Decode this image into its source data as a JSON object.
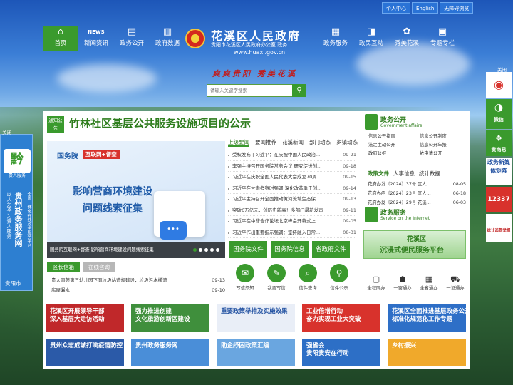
{
  "topbar": [
    "个人中心",
    "English",
    "无障碍浏览"
  ],
  "nav": {
    "items": [
      {
        "label": "首页",
        "icon": "⌂",
        "active": true
      },
      {
        "label": "新闻资讯",
        "icon": "NEWS"
      },
      {
        "label": "政务公开",
        "icon": "▤"
      },
      {
        "label": "政府数据",
        "icon": "▥"
      },
      {
        "label": "政务服务",
        "icon": "▦"
      },
      {
        "label": "政民互动",
        "icon": "◨"
      },
      {
        "label": "秀美花溪",
        "icon": "✿"
      },
      {
        "label": "专题专栏",
        "icon": "▣"
      }
    ]
  },
  "logo": {
    "title": "花溪区人民政府",
    "subtitle": "贵阳市花溪区人民政府办公室.政务",
    "url": "www.huaxi.gov.cn"
  },
  "slogan": "爽爽贵阳 秀美花溪",
  "search": {
    "placeholder": "请输入关键字搜索",
    "button_icon": "search-icon"
  },
  "headline": {
    "badge": "通知公告",
    "title": "竹林社区基层公共服务设施项目的公示"
  },
  "banner": {
    "org": "国务院",
    "tag": "互联网+督查",
    "line1": "影响营商环境建设",
    "line2": "问题线索征集",
    "caption": "国务院互联网+督查 影响营商环境建设问题线索征集",
    "dots": 5,
    "active_dot": 0
  },
  "news": {
    "tabs": [
      "上级要闻",
      "要闻推荐",
      "花溪新闻",
      "部门动态",
      "乡镇动态"
    ],
    "active_tab": 0,
    "items": [
      {
        "title": "受权发布丨习近平：在庆祝中国人民政治...",
        "date": "09-21"
      },
      {
        "title": "李强主持召开国务院常务会议 研究促进创...",
        "date": "09-18"
      },
      {
        "title": "习近平在庆祝全国人民代表大会成立70周...",
        "date": "09-15"
      },
      {
        "title": "习近平在甘肃考察时强调 深化改革勇于创...",
        "date": "09-14"
      },
      {
        "title": "习近平主持召开全面推动黄河流域生态保...",
        "date": "09-13"
      },
      {
        "title": "突破6万亿元，创历史新高！多部门最新发声",
        "date": "09-11"
      },
      {
        "title": "习近平在中非合作论坛北京峰会开幕式上...",
        "date": "09-05"
      },
      {
        "title": "习近平作出重要指示强调：坚持融入日常...",
        "date": "08-31"
      }
    ],
    "buttons": [
      "国务院文件",
      "国务院信息",
      "省政府文件"
    ]
  },
  "mailbox": {
    "tabs": [
      "区长信箱",
      "在线咨询"
    ],
    "items": [
      {
        "title": "贵大南苑第三幼儿园下面垃圾站违规建设，垃圾污水横流",
        "date": "09-13"
      },
      {
        "title": "房屋漏水",
        "date": "09-10"
      }
    ],
    "actions": [
      {
        "label": "写信须知",
        "icon": "✉"
      },
      {
        "label": "我要写信",
        "icon": "✎"
      },
      {
        "label": "信件查询",
        "icon": "⌕"
      },
      {
        "label": "信件公示",
        "icon": "⚲"
      }
    ]
  },
  "gov_open": {
    "title": "政务公开",
    "subtitle": "Government affairs",
    "links": [
      "信息公开指南",
      "信息公开制度",
      "法定主动公开",
      "信息公开年报",
      "政府公报",
      "依申请公开"
    ]
  },
  "files": {
    "tabs": [
      "政策文件",
      "人事信息",
      "统计数据"
    ],
    "items": [
      {
        "title": "花府办发〔2024〕37号 区人...",
        "date": "08-05"
      },
      {
        "title": "花府办函〔2024〕23号 区人...",
        "date": "06-18"
      },
      {
        "title": "花府办发〔2024〕29号 花溪...",
        "date": "06-03"
      }
    ]
  },
  "service": {
    "title": "政务服务",
    "subtitle": "Service on the Internet",
    "banner_a": "花溪区",
    "banner_b": "沉浸式便民服务平台",
    "links": [
      {
        "label": "全程网办",
        "icon": "▢"
      },
      {
        "label": "一窗通办",
        "icon": "☗"
      },
      {
        "label": "全省通办",
        "icon": "▦"
      },
      {
        "label": "一证通办",
        "icon": "⛟"
      }
    ]
  },
  "thumbs": [
    {
      "text": "花溪区开展领导干部\n深入基层大走访活动",
      "bg": "#c0282a"
    },
    {
      "text": "强力推进创建\n文化旅游创新区建设",
      "bg": "#3f8f3c"
    },
    {
      "text": "重要政策举措及实施效果",
      "bg": "#e9eef7",
      "color": "#1f4fa0"
    },
    {
      "text": "工业倍增行动\n奋力实现工业大突破",
      "bg": "#d8322c"
    },
    {
      "text": "花溪区全面推进基层政务公开\n标准化规范化工作专题",
      "bg": "#2e6fc7"
    },
    {
      "text": "贵州众志成城打响疫情防控",
      "bg": "#2b5aa8"
    },
    {
      "text": "贵州政务服务网",
      "bg": "#4a8ed8"
    },
    {
      "text": "助企纾困政策汇编",
      "bg": "#6aa6e0"
    },
    {
      "text": "强省会\n贵阳贵安在行动",
      "bg": "#2d6fc6"
    },
    {
      "text": "乡村振兴",
      "bg": "#f0a92b"
    }
  ],
  "left_float": {
    "close": "关闭",
    "icon_text": "黔",
    "sub": "贵人服务",
    "title": "贵州政务服务网",
    "side_a": "全国一体化在线政务服务平台",
    "side_b": "以人为本 为贵人服务",
    "foot": "贵阳市"
  },
  "right_float": {
    "close": "关闭",
    "items": [
      "微博",
      "微信",
      "贵商易",
      "政务新媒体矩阵",
      "12337",
      "统计造假举报"
    ]
  }
}
